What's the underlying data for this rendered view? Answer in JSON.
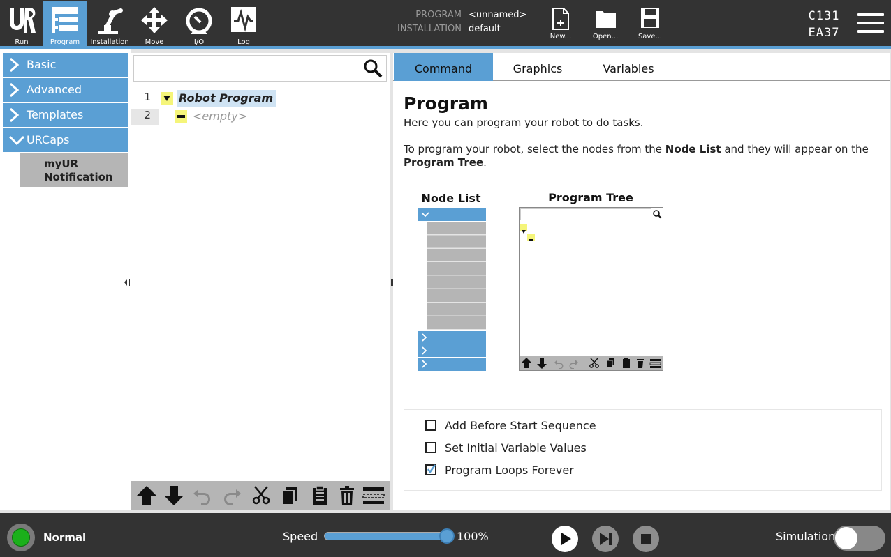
{
  "topbar": {
    "nav": [
      {
        "id": "run",
        "label": "Run",
        "icon": "ur-logo-icon",
        "active": false
      },
      {
        "id": "program",
        "label": "Program",
        "icon": "program-tree-icon",
        "active": true
      },
      {
        "id": "installation",
        "label": "Installation",
        "icon": "robot-arm-icon",
        "active": false
      },
      {
        "id": "move",
        "label": "Move",
        "icon": "move-arrows-icon",
        "active": false
      },
      {
        "id": "io",
        "label": "I/O",
        "icon": "io-gauge-icon",
        "active": false
      },
      {
        "id": "log",
        "label": "Log",
        "icon": "log-chart-icon",
        "active": false
      }
    ],
    "program_key": "PROGRAM",
    "program_value": "<unnamed>",
    "installation_key": "INSTALLATION",
    "installation_value": "default",
    "file_buttons": [
      {
        "id": "new",
        "label": "New...",
        "icon": "new-file-icon"
      },
      {
        "id": "open",
        "label": "Open...",
        "icon": "open-folder-icon"
      },
      {
        "id": "save",
        "label": "Save...",
        "icon": "save-disk-icon"
      }
    ],
    "robot_id_line1": "C131",
    "robot_id_line2": "EA37"
  },
  "sidebar": {
    "items": [
      {
        "label": "Basic",
        "expanded": false
      },
      {
        "label": "Advanced",
        "expanded": false
      },
      {
        "label": "Templates",
        "expanded": false
      },
      {
        "label": "URCaps",
        "expanded": true
      }
    ],
    "sub_item": "myUR Notification"
  },
  "tree": {
    "search_placeholder": "",
    "rows": [
      {
        "line": "1",
        "label": "Robot Program"
      },
      {
        "line": "2",
        "label": "<empty>"
      }
    ]
  },
  "content": {
    "tabs": [
      {
        "label": "Command",
        "active": true
      },
      {
        "label": "Graphics",
        "active": false
      },
      {
        "label": "Variables",
        "active": false
      }
    ],
    "title": "Program",
    "desc1": "Here you can program your robot to do tasks.",
    "desc2_a": "To program your robot, select the nodes from the ",
    "desc2_b": "Node List",
    "desc2_c": " and they will appear on the ",
    "desc2_d": "Program Tree",
    "desc2_e": ".",
    "node_list_title": "Node List",
    "program_tree_title": "Program Tree",
    "options": [
      {
        "label": "Add Before Start Sequence",
        "checked": false
      },
      {
        "label": "Set Initial Variable Values",
        "checked": false
      },
      {
        "label": "Program Loops Forever",
        "checked": true
      }
    ]
  },
  "bottombar": {
    "status": "Normal",
    "speed_label": "Speed",
    "speed_value": "100%",
    "speed_fraction": 1.0,
    "simulation_label": "Simulation",
    "simulation_on": false
  },
  "colors": {
    "accent": "#5a9fd4",
    "bar": "#333333",
    "tree_node": "#f5f57a",
    "status_ok": "#1bb01b"
  }
}
